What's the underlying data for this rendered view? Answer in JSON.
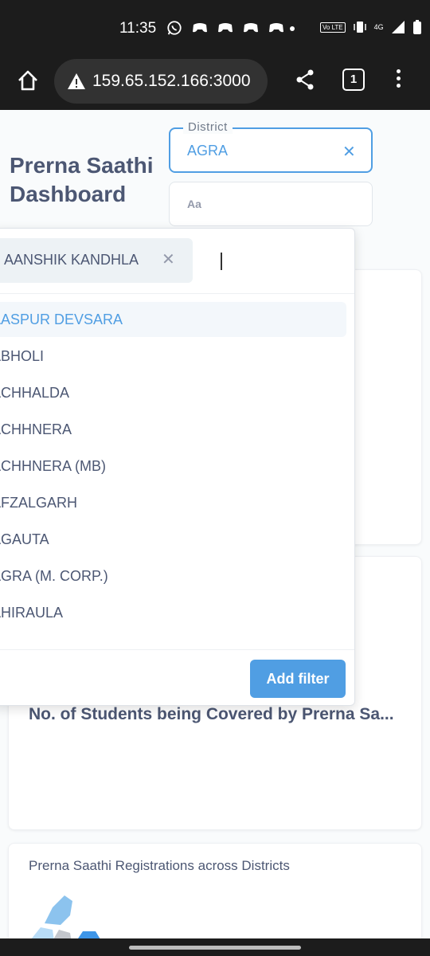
{
  "status_bar": {
    "time": "11:35",
    "network": "4G",
    "lte_label": "Vo LTE"
  },
  "browser": {
    "url": "159.65.152.166:3000",
    "tab_count": "1"
  },
  "page": {
    "title": "Prerna Saathi Dashboard"
  },
  "filters": {
    "district": {
      "legend": "District",
      "value": "AGRA"
    },
    "block": {
      "placeholder": "Aa"
    }
  },
  "dropdown": {
    "selected_chip": "AANSHIK KANDHLA",
    "options": [
      {
        "label": "AASPUR DEVSARA",
        "active": true
      },
      {
        "label": "ABHOLI",
        "active": false
      },
      {
        "label": "ACHHALDA",
        "active": false
      },
      {
        "label": "ACHHNERA",
        "active": false
      },
      {
        "label": "ACHHNERA (MB)",
        "active": false
      },
      {
        "label": "AFZALGARH",
        "active": false
      },
      {
        "label": "AGAUTA",
        "active": false
      },
      {
        "label": "AGRA (M. CORP.)",
        "active": false
      },
      {
        "label": "AHIRAULA",
        "active": false
      }
    ],
    "add_filter_label": "Add filter"
  },
  "cards": {
    "students_title": "No. of Students being Covered by Prerna Sa...",
    "registrations_title": "Prerna Saathi Registrations across Districts"
  },
  "colors": {
    "accent": "#509ee3",
    "text": "#4c5773"
  }
}
